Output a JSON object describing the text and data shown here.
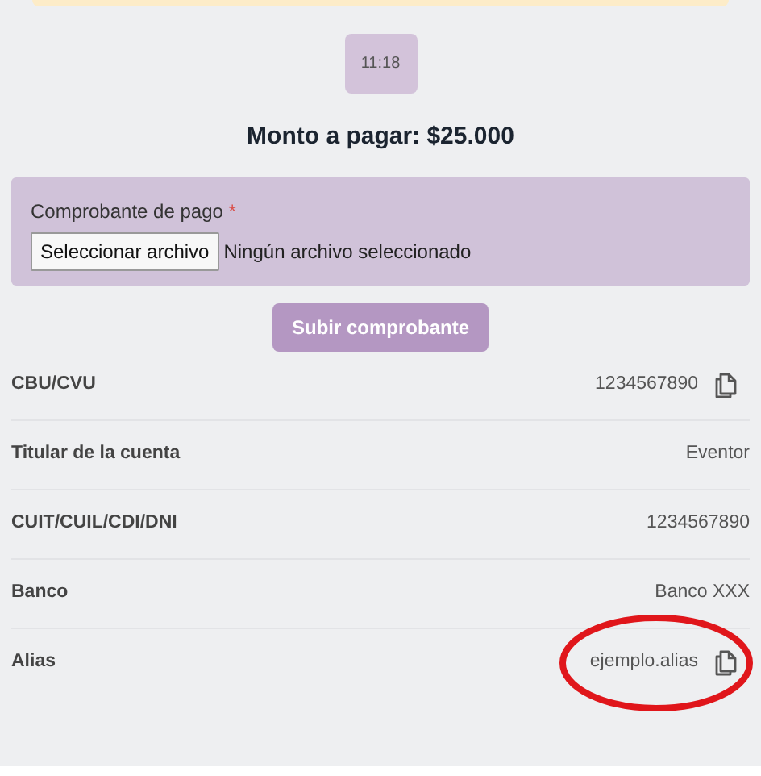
{
  "time_badge": "11:18",
  "amount_heading": "Monto a pagar: $25.000",
  "upload": {
    "label": "Comprobante de pago",
    "required_mark": "*",
    "file_button": "Seleccionar archivo",
    "file_status": "Ningún archivo seleccionado"
  },
  "submit_button": "Subir comprobante",
  "details": [
    {
      "label": "CBU/CVU",
      "value": "1234567890",
      "copyable": true,
      "highlighted": false
    },
    {
      "label": "Titular de la cuenta",
      "value": "Eventor",
      "copyable": false,
      "highlighted": false
    },
    {
      "label": "CUIT/CUIL/CDI/DNI",
      "value": "1234567890",
      "copyable": false,
      "highlighted": false
    },
    {
      "label": "Banco",
      "value": "Banco XXX",
      "copyable": false,
      "highlighted": false
    },
    {
      "label": "Alias",
      "value": "ejemplo.alias",
      "copyable": true,
      "highlighted": true
    }
  ]
}
